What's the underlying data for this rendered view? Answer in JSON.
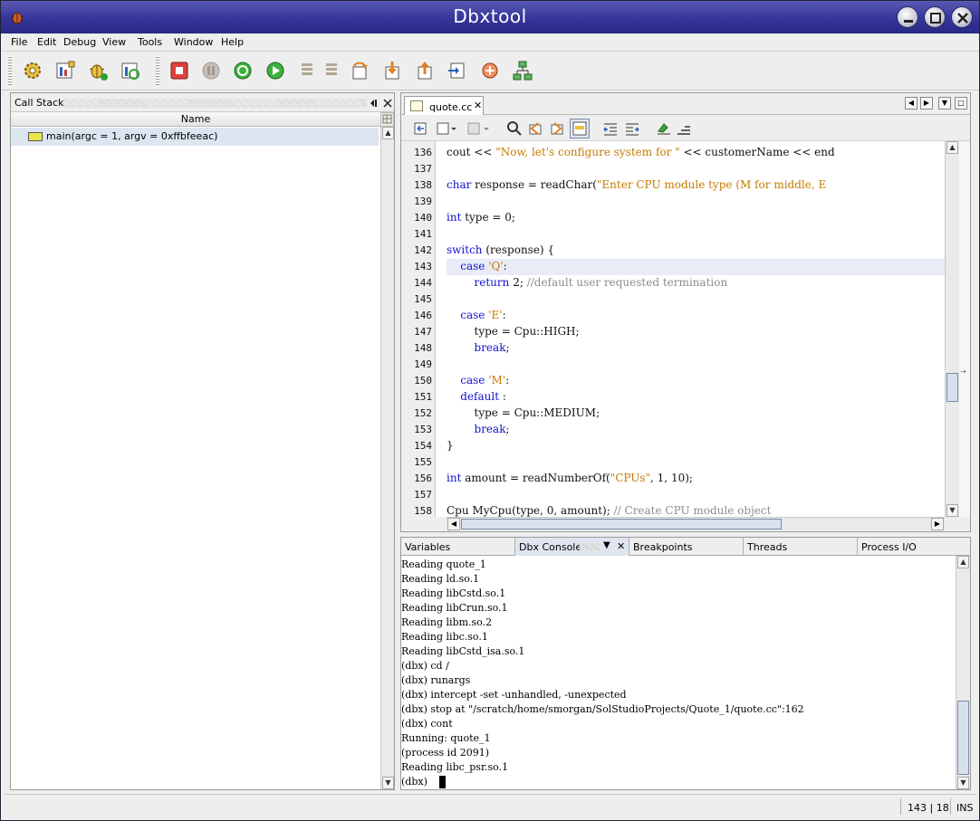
{
  "window": {
    "title": "Dbxtool"
  },
  "menu": [
    "File",
    "Edit",
    "Debug",
    "View",
    "Tools",
    "Window",
    "Help"
  ],
  "callstack": {
    "title": "Call Stack",
    "column": "Name",
    "frames": [
      "main(argc = 1, argv = 0xffbfeeac)"
    ]
  },
  "editor": {
    "tab": "quote.cc",
    "highlight_line": 143,
    "lines": [
      {
        "n": "136",
        "parts": [
          {
            "t": "cout << ",
            "c": ""
          },
          {
            "t": "\"Now, let's configure system for \"",
            "c": "st"
          },
          {
            "t": " << customerName << end",
            "c": ""
          }
        ]
      },
      {
        "n": "137",
        "parts": []
      },
      {
        "n": "138",
        "parts": [
          {
            "t": "char",
            "c": "kw"
          },
          {
            "t": " response = readChar(",
            "c": ""
          },
          {
            "t": "\"Enter CPU module type (M for middle, E",
            "c": "st"
          }
        ]
      },
      {
        "n": "139",
        "parts": []
      },
      {
        "n": "140",
        "parts": [
          {
            "t": "int",
            "c": "kw"
          },
          {
            "t": " type = 0;",
            "c": ""
          }
        ]
      },
      {
        "n": "141",
        "parts": []
      },
      {
        "n": "142",
        "parts": [
          {
            "t": "switch",
            "c": "kw"
          },
          {
            "t": " (response) {",
            "c": ""
          }
        ]
      },
      {
        "n": "143",
        "parts": [
          {
            "t": "    ",
            "c": ""
          },
          {
            "t": "case",
            "c": "kw"
          },
          {
            "t": " ",
            "c": ""
          },
          {
            "t": "'Q'",
            "c": "st"
          },
          {
            "t": ":",
            "c": ""
          }
        ]
      },
      {
        "n": "144",
        "parts": [
          {
            "t": "        ",
            "c": ""
          },
          {
            "t": "return",
            "c": "kw"
          },
          {
            "t": " 2; ",
            "c": ""
          },
          {
            "t": "//default user requested termination",
            "c": "cm"
          }
        ]
      },
      {
        "n": "145",
        "parts": []
      },
      {
        "n": "146",
        "parts": [
          {
            "t": "    ",
            "c": ""
          },
          {
            "t": "case",
            "c": "kw"
          },
          {
            "t": " ",
            "c": ""
          },
          {
            "t": "'E'",
            "c": "st"
          },
          {
            "t": ":",
            "c": ""
          }
        ]
      },
      {
        "n": "147",
        "parts": [
          {
            "t": "        type = Cpu::HIGH;",
            "c": ""
          }
        ]
      },
      {
        "n": "148",
        "parts": [
          {
            "t": "        ",
            "c": ""
          },
          {
            "t": "break",
            "c": "kw"
          },
          {
            "t": ";",
            "c": ""
          }
        ]
      },
      {
        "n": "149",
        "parts": []
      },
      {
        "n": "150",
        "parts": [
          {
            "t": "    ",
            "c": ""
          },
          {
            "t": "case",
            "c": "kw"
          },
          {
            "t": " ",
            "c": ""
          },
          {
            "t": "'M'",
            "c": "st"
          },
          {
            "t": ":",
            "c": ""
          }
        ]
      },
      {
        "n": "151",
        "parts": [
          {
            "t": "    ",
            "c": ""
          },
          {
            "t": "default",
            "c": "kw"
          },
          {
            "t": " :",
            "c": ""
          }
        ]
      },
      {
        "n": "152",
        "parts": [
          {
            "t": "        type = Cpu::MEDIUM;",
            "c": ""
          }
        ]
      },
      {
        "n": "153",
        "parts": [
          {
            "t": "        ",
            "c": ""
          },
          {
            "t": "break",
            "c": "kw"
          },
          {
            "t": ";",
            "c": ""
          }
        ]
      },
      {
        "n": "154",
        "parts": [
          {
            "t": "}",
            "c": ""
          }
        ]
      },
      {
        "n": "155",
        "parts": []
      },
      {
        "n": "156",
        "parts": [
          {
            "t": "int",
            "c": "kw"
          },
          {
            "t": " amount = readNumberOf(",
            "c": ""
          },
          {
            "t": "\"CPUs\"",
            "c": "st"
          },
          {
            "t": ", 1, 10);",
            "c": ""
          }
        ]
      },
      {
        "n": "157",
        "parts": []
      },
      {
        "n": "158",
        "parts": [
          {
            "t": "Cpu MyCpu(type, 0, amount); ",
            "c": ""
          },
          {
            "t": "// Create CPU module object",
            "c": "cm"
          }
        ]
      }
    ]
  },
  "bottom": {
    "tabs": [
      "Variables",
      "Dbx Console",
      "Breakpoints",
      "Threads",
      "Process I/O"
    ],
    "console": [
      "Reading quote_1",
      "Reading ld.so.1",
      "Reading libCstd.so.1",
      "Reading libCrun.so.1",
      "Reading libm.so.2",
      "Reading libc.so.1",
      "Reading libCstd_isa.so.1",
      "(dbx) cd /",
      "(dbx) runargs",
      "(dbx) intercept -set -unhandled, -unexpected",
      "(dbx) stop at \"/scratch/home/smorgan/SolStudioProjects/Quote_1/quote.cc\":162",
      "(dbx) cont",
      "Running: quote_1",
      "(process id 2091)",
      "Reading libc_psr.so.1",
      "(dbx) "
    ]
  },
  "status": {
    "position": "143 | 18",
    "mode": "INS"
  }
}
